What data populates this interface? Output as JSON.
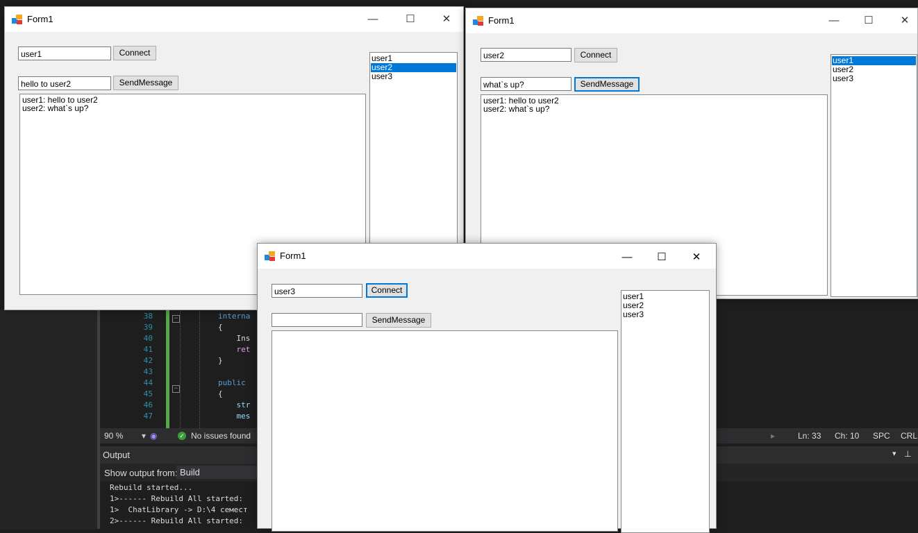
{
  "colors": {
    "selection": "#0078d7",
    "ide_bg": "#1e1e1e",
    "status_ok": "#3a9d3a"
  },
  "windows": [
    {
      "title": "Form1",
      "username": "user1",
      "connect_label": "Connect",
      "message_value": "hello to user2",
      "send_label": "SendMessage",
      "chat_lines": [
        "user1: hello to user2",
        "user2: what`s up?"
      ],
      "users": [
        "user1",
        "user2",
        "user3"
      ],
      "selected_user": "user2"
    },
    {
      "title": "Form1",
      "username": "user2",
      "connect_label": "Connect",
      "message_value": "what`s up?",
      "send_label": "SendMessage",
      "chat_lines": [
        "user1: hello to user2",
        "user2: what`s up?"
      ],
      "users": [
        "user1",
        "user2",
        "user3"
      ],
      "selected_user": "user1"
    },
    {
      "title": "Form1",
      "username": "user3",
      "connect_label": "Connect",
      "message_value": "",
      "send_label": "SendMessage",
      "chat_lines": [],
      "users": [
        "user1",
        "user2",
        "user3"
      ],
      "selected_user": ""
    }
  ],
  "window_controls": {
    "minimize_icon": "minimize-icon",
    "maximize_icon": "maximize-icon",
    "close_icon": "close-icon"
  },
  "ide": {
    "code_lines": [
      {
        "num": "38",
        "text": "interna"
      },
      {
        "num": "39",
        "text": "{"
      },
      {
        "num": "40",
        "text": "    Ins"
      },
      {
        "num": "41",
        "text": "    ret"
      },
      {
        "num": "42",
        "text": "}"
      },
      {
        "num": "43",
        "text": ""
      },
      {
        "num": "44",
        "text": "public "
      },
      {
        "num": "45",
        "text": "{"
      },
      {
        "num": "46",
        "text": "    str"
      },
      {
        "num": "47",
        "text": "    mes"
      }
    ],
    "status": {
      "zoom": "90 %",
      "issues": "No issues found",
      "ln": "Ln: 33",
      "ch": "Ch: 10",
      "spc": "SPC",
      "crlf": "CRL"
    },
    "output": {
      "title": "Output",
      "show_from_label": "Show output from:",
      "source": "Build",
      "lines": [
        "Rebuild started...",
        "1>------ Rebuild All started: ",
        "1>  ChatLibrary -> D:\\4 семест",
        "2>------ Rebuild All started: "
      ]
    }
  }
}
